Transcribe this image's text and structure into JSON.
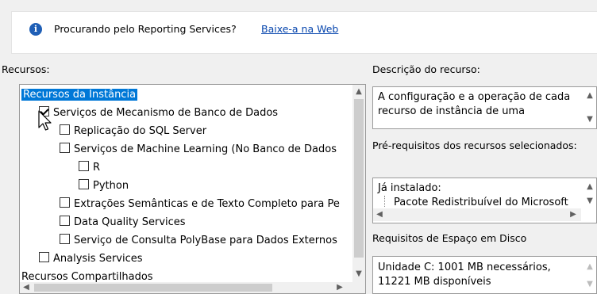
{
  "info": {
    "message": "Procurando pelo Reporting Services?",
    "link": "Baixe-a na Web"
  },
  "left": {
    "label": "Recursos:",
    "tree": [
      {
        "text": "Recursos da Instância",
        "level": 0,
        "checkbox": false,
        "selected": true
      },
      {
        "text": "Serviços de Mecanismo de Banco de Dados",
        "level": 1,
        "checkbox": true,
        "checked": true
      },
      {
        "text": "Replicação do SQL Server",
        "level": 2,
        "checkbox": true,
        "checked": false
      },
      {
        "text": "Serviços de Machine Learning (No Banco de Dados",
        "level": 2,
        "checkbox": true,
        "checked": false
      },
      {
        "text": "R",
        "level": 3,
        "checkbox": true,
        "checked": false
      },
      {
        "text": "Python",
        "level": 3,
        "checkbox": true,
        "checked": false
      },
      {
        "text": "Extrações Semânticas e de Texto Completo para Pe",
        "level": 2,
        "checkbox": true,
        "checked": false
      },
      {
        "text": "Data Quality Services",
        "level": 2,
        "checkbox": true,
        "checked": false
      },
      {
        "text": "Serviço de Consulta PolyBase para Dados Externos",
        "level": 2,
        "checkbox": true,
        "checked": false
      },
      {
        "text": "Analysis Services",
        "level": 1,
        "checkbox": true,
        "checked": false
      },
      {
        "text": "Recursos Compartilhados",
        "level": 0,
        "checkbox": false,
        "selected": false
      }
    ]
  },
  "right": {
    "desc_label": "Descrição do recurso:",
    "desc_text": "A configuração e a operação de cada recurso de instância de uma",
    "prereq_label": "Pré-requisitos dos recursos selecionados:",
    "installed_label": "Já instalado:",
    "installed_item": "Pacote Redistribuível do Microsoft",
    "disk_label": "Requisitos de Espaço em Disco",
    "disk_text": "Unidade C: 1001 MB necessários, 11221 MB disponíveis"
  },
  "icons": {
    "info": "info-icon",
    "up": "chevron-up-icon",
    "down": "chevron-down-icon",
    "left": "chevron-left-icon",
    "right": "chevron-right-icon"
  }
}
